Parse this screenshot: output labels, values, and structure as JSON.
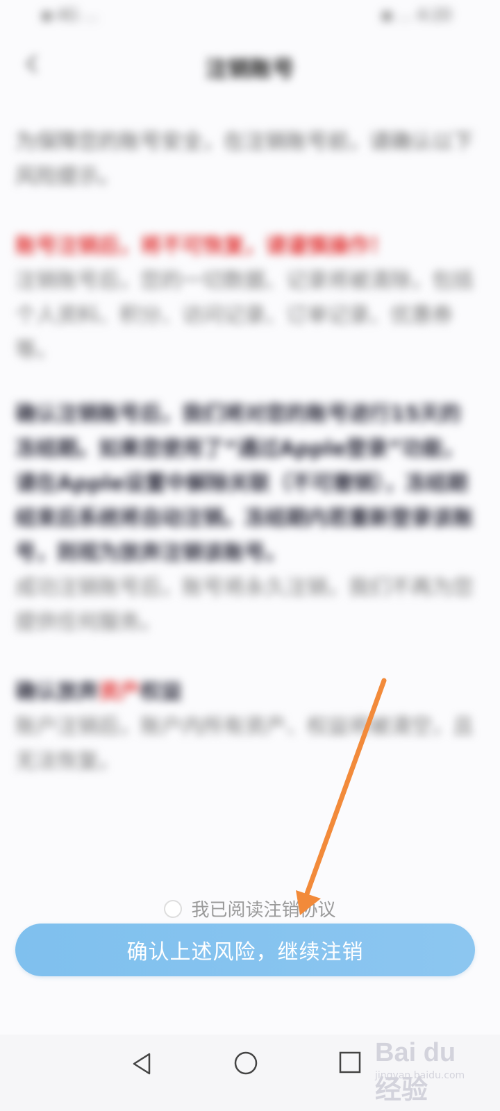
{
  "status_bar": {
    "left": "▪︎ 4G …",
    "right": "▪︎ … 4:20"
  },
  "header": {
    "title": "注销账号"
  },
  "content": {
    "intro": "为保障您的账号安全，在注销账号前，请确认以下风险提示。",
    "warning_title": "账号注销后，将不可恢复，请谨慎操作！",
    "warning_body": "注销账号后，您的一切数据、记录将被清除，包括个人资料、积分、访问记录、订单记录、优惠券等。",
    "apple_notice": "确认注销账号后，我们将对您的账号进行15天的冻结期。如果您使用了“通过Apple登录”功能，请在Apple设置中解除关联（不可撤销），冻结期结束后系统将自动注销。冻结期内若重新登录该账号，则视为放弃注销该账号。",
    "completion_note": "成功注销账号后，账号将永久注销，我们不再为您提供任何服务。",
    "asset_heading_pre": "确认放弃",
    "asset_heading_hl": "资产",
    "asset_heading_post": "权益",
    "asset_body": "账户注销后，账户内所有资产、权益将被清空，且无法恢复。"
  },
  "agreement": {
    "label": "我已阅读注销协议"
  },
  "confirm_button": {
    "label": "确认上述风险，继续注销"
  },
  "watermark": {
    "text": "Bai du 经验",
    "sub": "jingyan.baidu.com"
  },
  "colors": {
    "accent_button": "#8cc6f0",
    "warning_red": "#e23a3a",
    "arrow": "#f28a3a"
  }
}
